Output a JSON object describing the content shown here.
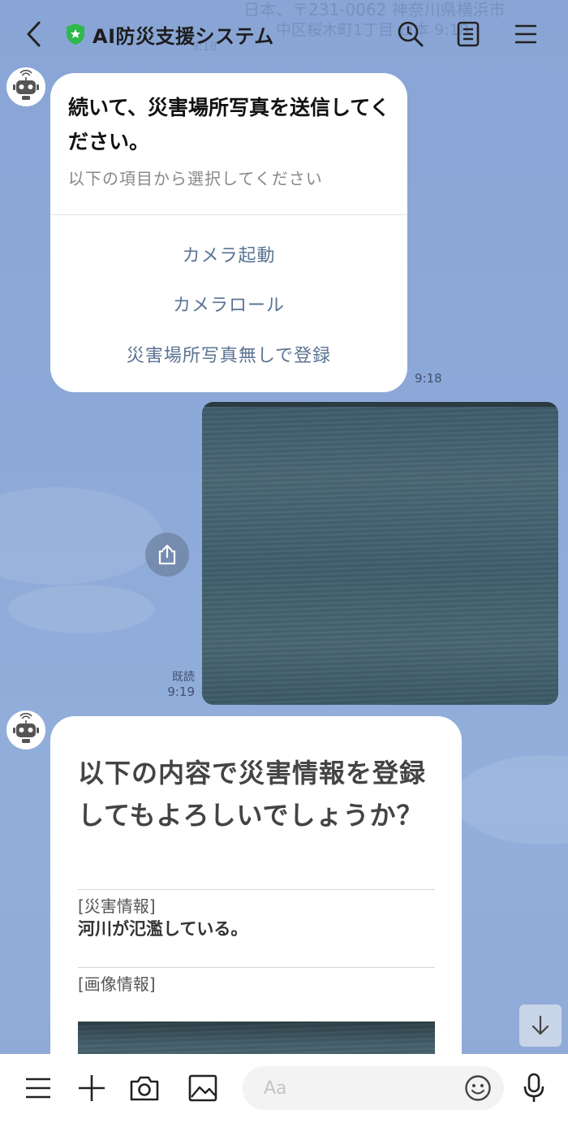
{
  "header": {
    "title": "AI防災支援システム",
    "ghost_text_1": "日本、〒231-0062 神奈川県横浜市",
    "ghost_text_2": "中区桜木町1丁目 日本 9:18",
    "ghost_time": "9:18"
  },
  "messages": {
    "bot1": {
      "title": "続いて、災害場所写真を送信してください。",
      "subtitle": "以下の項目から選択してください",
      "actions": [
        "カメラ起動",
        "カメラロール",
        "災害場所写真無しで登録"
      ],
      "time": "9:18"
    },
    "user_photo": {
      "read_label": "既読",
      "time": "9:19"
    },
    "bot2": {
      "title": "以下の内容で災害情報を登録してもよろしいでしょうか？",
      "disaster_label": "[災害情報]",
      "disaster_value": "河川が氾濫している。",
      "image_label": "[画像情報]"
    }
  },
  "input": {
    "placeholder": "Aa"
  },
  "icons": {
    "back": "chevron-left-icon",
    "verified": "shield-star-icon",
    "search": "search-icon",
    "notes": "notes-icon",
    "menu": "menu-icon",
    "share": "share-icon",
    "scroll_down": "arrow-down-icon",
    "keyboard_menu": "menu-icon",
    "plus": "plus-icon",
    "camera": "camera-icon",
    "image": "image-icon",
    "emoji": "emoji-icon",
    "mic": "mic-icon"
  },
  "colors": {
    "background": "#8aa6d6",
    "bubble": "#ffffff",
    "action_text": "#5a7392",
    "verified_green": "#2fb84b"
  }
}
